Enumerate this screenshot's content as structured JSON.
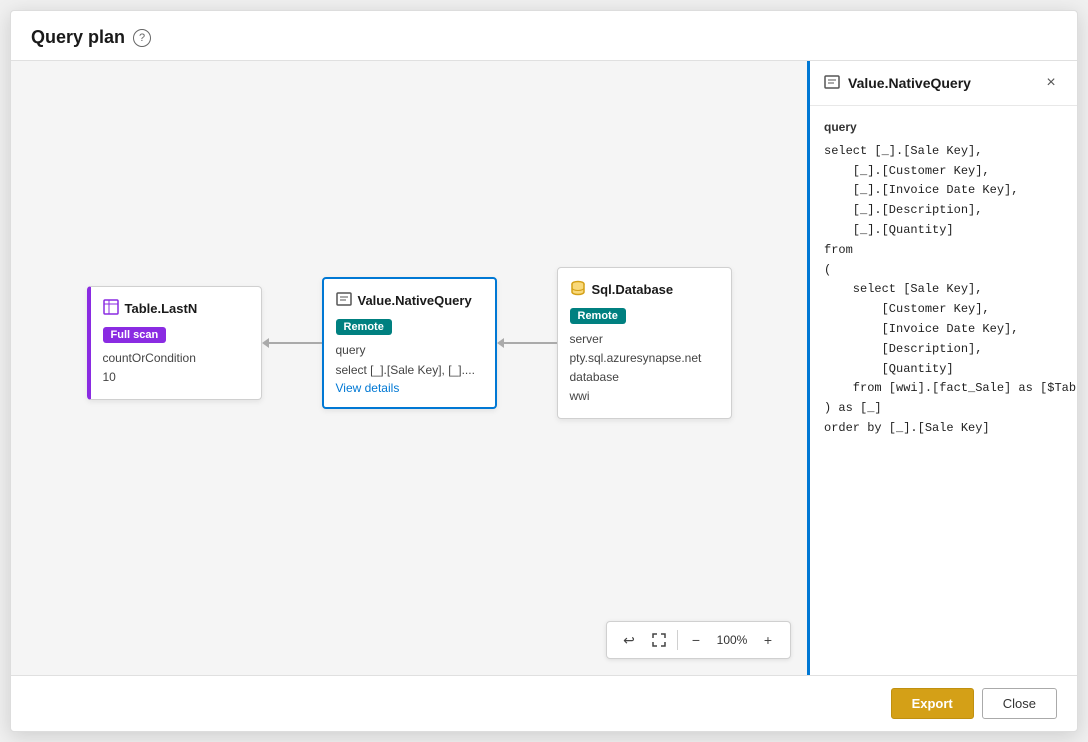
{
  "dialog": {
    "title": "Query plan",
    "help_label": "?"
  },
  "nodes": [
    {
      "id": "table-lastn",
      "icon": "table-icon",
      "icon_char": "⊞",
      "title": "Table.LastN",
      "badge": "Full scan",
      "badge_type": "purple",
      "lines": [
        "countOrCondition",
        "10"
      ]
    },
    {
      "id": "value-nativequery",
      "icon": "query-icon",
      "icon_char": "⬡",
      "title": "Value.NativeQuery",
      "badge": "Remote",
      "badge_type": "teal",
      "lines": [
        "query",
        "select [_].[Sale Key], [_]...."
      ],
      "link": "View details"
    },
    {
      "id": "sql-database",
      "icon": "database-icon",
      "icon_char": "🗄",
      "title": "Sql.Database",
      "badge": "Remote",
      "badge_type": "teal",
      "lines": [
        "server",
        "pty.sql.azuresynapse.net",
        "database",
        "wwi"
      ]
    }
  ],
  "canvas_toolbar": {
    "undo_label": "↩",
    "fit_label": "⊕",
    "zoom_out_label": "−",
    "zoom_in_label": "+",
    "zoom_level": "100%"
  },
  "right_panel": {
    "title": "Value.NativeQuery",
    "icon_char": "⬡",
    "close_label": "×",
    "section_label": "query",
    "query_text": "select [_].[Sale Key],\n    [_].[Customer Key],\n    [_].[Invoice Date Key],\n    [_].[Description],\n    [_].[Quantity]\nfrom\n(\n    select [Sale Key],\n        [Customer Key],\n        [Invoice Date Key],\n        [Description],\n        [Quantity]\n    from [wwi].[fact_Sale] as [$Table]\n) as [_]\norder by [_].[Sale Key]"
  },
  "footer": {
    "export_label": "Export",
    "close_label": "Close"
  }
}
